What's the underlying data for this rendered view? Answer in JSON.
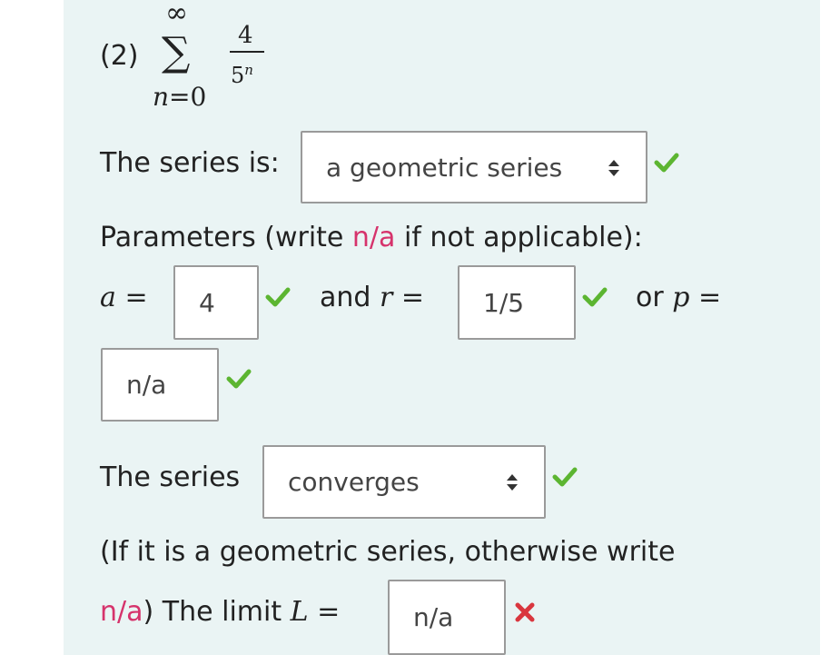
{
  "problem": {
    "label": "(2)",
    "sum_upper": "∞",
    "sum_lower": "n=0",
    "numerator": "4",
    "denominator_base": "5",
    "denominator_exp": "n"
  },
  "series_type": {
    "label": "The series is:",
    "selected": "a geometric series",
    "status": "correct"
  },
  "parameters": {
    "intro_prefix": "Parameters (write ",
    "intro_na": "n/a",
    "intro_suffix": " if not applicable):",
    "a_symbol": "a",
    "equals": "=",
    "a_value": "4",
    "a_status": "correct",
    "and_text": "and ",
    "r_symbol": "r",
    "r_value": "1/5",
    "r_status": "correct",
    "or_text": "or ",
    "p_symbol": "p",
    "p_value": "n/a",
    "p_status": "correct"
  },
  "convergence": {
    "label": "The series",
    "selected": "converges",
    "status": "correct"
  },
  "limit": {
    "line1": "(If it is a geometric series, otherwise write",
    "na": "n/a",
    "paren_close": ")",
    "text": " The limit ",
    "L_symbol": "L",
    "equals": "=",
    "value": "n/a",
    "status": "incorrect"
  },
  "colors": {
    "correct": "#5cb531",
    "incorrect": "#d9363e",
    "na_pink": "#d6336c",
    "panel": "#eaf4f4"
  }
}
